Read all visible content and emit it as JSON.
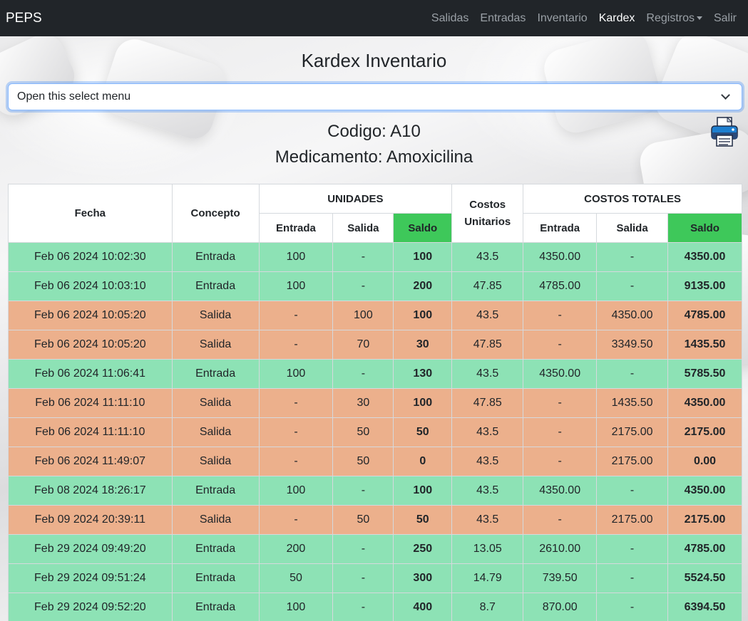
{
  "nav": {
    "brand": "PEPS",
    "links": [
      "Salidas",
      "Entradas",
      "Inventario",
      "Kardex",
      "Registros",
      "Salir"
    ]
  },
  "title": "Kardex Inventario",
  "select": {
    "value": "Open this select menu"
  },
  "codigo": "Codigo: A10",
  "medicamento": "Medicamento: Amoxicilina",
  "table": {
    "headers": {
      "fecha": "Fecha",
      "concepto": "Concepto",
      "unidades": "UNIDADES",
      "costos_unitarios": "Costos Unitarios",
      "costos_totales": "COSTOS TOTALES",
      "entrada": "Entrada",
      "salida": "Salida",
      "saldo": "Saldo"
    },
    "rows": [
      [
        "Feb 06 2024 10:02:30",
        "Entrada",
        "100",
        "-",
        "100",
        "43.5",
        "4350.00",
        "-",
        "4350.00"
      ],
      [
        "Feb 06 2024 10:03:10",
        "Entrada",
        "100",
        "-",
        "200",
        "47.85",
        "4785.00",
        "-",
        "9135.00"
      ],
      [
        "Feb 06 2024 10:05:20",
        "Salida",
        "-",
        "100",
        "100",
        "43.5",
        "-",
        "4350.00",
        "4785.00"
      ],
      [
        "Feb 06 2024 10:05:20",
        "Salida",
        "-",
        "70",
        "30",
        "47.85",
        "-",
        "3349.50",
        "1435.50"
      ],
      [
        "Feb 06 2024 11:06:41",
        "Entrada",
        "100",
        "-",
        "130",
        "43.5",
        "4350.00",
        "-",
        "5785.50"
      ],
      [
        "Feb 06 2024 11:11:10",
        "Salida",
        "-",
        "30",
        "100",
        "47.85",
        "-",
        "1435.50",
        "4350.00"
      ],
      [
        "Feb 06 2024 11:11:10",
        "Salida",
        "-",
        "50",
        "50",
        "43.5",
        "-",
        "2175.00",
        "2175.00"
      ],
      [
        "Feb 06 2024 11:49:07",
        "Salida",
        "-",
        "50",
        "0",
        "43.5",
        "-",
        "2175.00",
        "0.00"
      ],
      [
        "Feb 08 2024 18:26:17",
        "Entrada",
        "100",
        "-",
        "100",
        "43.5",
        "4350.00",
        "-",
        "4350.00"
      ],
      [
        "Feb 09 2024 20:39:11",
        "Salida",
        "-",
        "50",
        "50",
        "43.5",
        "-",
        "2175.00",
        "2175.00"
      ],
      [
        "Feb 29 2024 09:49:20",
        "Entrada",
        "200",
        "-",
        "250",
        "13.05",
        "2610.00",
        "-",
        "4785.00"
      ],
      [
        "Feb 29 2024 09:51:24",
        "Entrada",
        "50",
        "-",
        "300",
        "14.79",
        "739.50",
        "-",
        "5524.50"
      ],
      [
        "Feb 29 2024 09:52:20",
        "Entrada",
        "100",
        "-",
        "400",
        "8.7",
        "870.00",
        "-",
        "6394.50"
      ]
    ]
  },
  "colors": {
    "navbar": "#212529",
    "entrada_row": "#8de2b5",
    "salida_row": "#ecb08c",
    "saldo_header": "#3ec85a"
  },
  "icons": {
    "print": "printer-icon"
  }
}
